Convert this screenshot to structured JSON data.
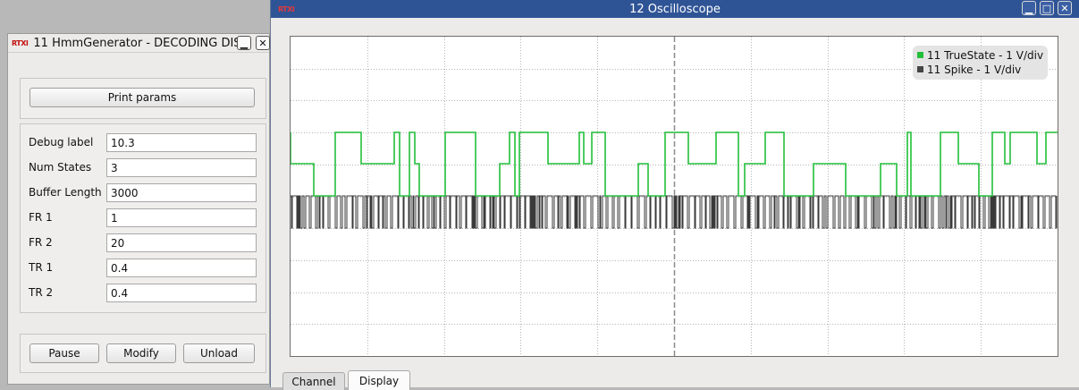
{
  "hmm_window": {
    "logo": "RTXI",
    "title": "11 HmmGenerator - DECODING DIS...",
    "print_params_label": "Print params",
    "params": [
      {
        "label": "Debug label",
        "value": "10.3"
      },
      {
        "label": "Num States",
        "value": "3"
      },
      {
        "label": "Buffer Length",
        "value": "3000"
      },
      {
        "label": "FR 1",
        "value": "1"
      },
      {
        "label": "FR 2",
        "value": "20"
      },
      {
        "label": "TR 1",
        "value": "0.4"
      },
      {
        "label": "TR 2",
        "value": "0.4"
      }
    ],
    "buttons": {
      "pause": "Pause",
      "modify": "Modify",
      "unload": "Unload"
    }
  },
  "scope_window": {
    "logo": "RTXI",
    "title": "12 Oscilloscope",
    "tabs": {
      "channel": "Channel",
      "display": "Display",
      "active": "display"
    },
    "legend": [
      {
        "label": "11 TrueState - 1 V/div",
        "color": "#22c03a"
      },
      {
        "label": "11 Spike - 1 V/div",
        "color": "#444444"
      }
    ],
    "colors": {
      "true_state": "#22c03a",
      "spike": "#3a3a3a",
      "grid": "#b5b5b5",
      "midline": "#8a8a8a"
    }
  },
  "window_buttons": {
    "minimize": "▁",
    "maximize": "□",
    "close": "✕"
  }
}
